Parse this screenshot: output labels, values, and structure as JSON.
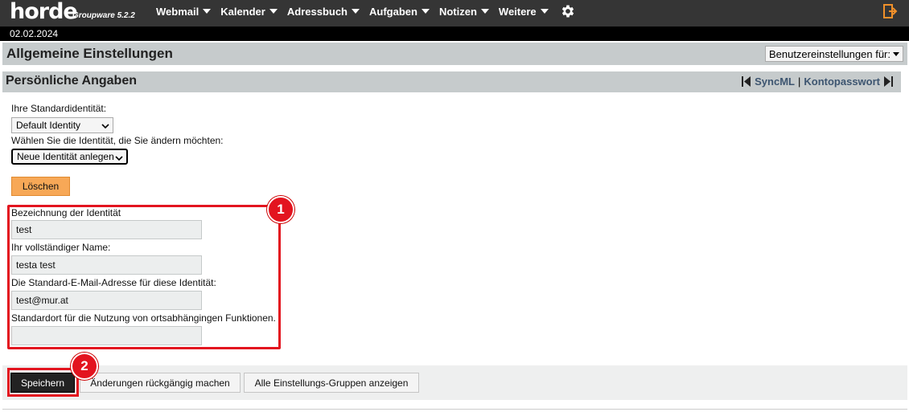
{
  "app": {
    "logo": "horde",
    "subtitle": "Groupware 5.2.2"
  },
  "nav": {
    "items": [
      {
        "label": "Webmail"
      },
      {
        "label": "Kalender"
      },
      {
        "label": "Adressbuch"
      },
      {
        "label": "Aufgaben"
      },
      {
        "label": "Notizen"
      },
      {
        "label": "Weitere"
      }
    ],
    "icons": [
      "gear-icon",
      "logout-icon"
    ]
  },
  "date": "02.02.2024",
  "page": {
    "title": "Allgemeine Einstellungen",
    "pref_select": "Benutzereinstellungen für:"
  },
  "section": {
    "title": "Persönliche Angaben",
    "link_syncml": "SyncML",
    "link_separator": "|",
    "link_password": "Kontopasswort"
  },
  "form": {
    "default_identity_label": "Ihre Standardidentität:",
    "default_identity_value": "Default Identity",
    "choose_identity_label": "Wählen Sie die Identität, die Sie ändern möchten:",
    "choose_identity_value": "Neue Identität anlegen",
    "delete_button": "Löschen",
    "identity_name_label": "Bezeichnung der Identität",
    "identity_name_value": "test",
    "full_name_label": "Ihr vollständiger Name:",
    "full_name_value": "testa test",
    "email_label": "Die Standard-E-Mail-Adresse für diese Identität:",
    "email_value": "test@mur.at",
    "location_label": "Standardort für die Nutzung von ortsabhängingen Funktionen.",
    "location_value": ""
  },
  "footer": {
    "save_button": "Speichern",
    "undo_button": "Änderungen rückgängig machen",
    "show_groups_button": "Alle Einstellungs-Gruppen anzeigen"
  },
  "annotations": {
    "badge1": "1",
    "badge2": "2"
  },
  "colors": {
    "topbar": "#353535",
    "header": "#c6cbcc",
    "accent_orange": "#f7a857",
    "annotation_red": "#e3141f"
  }
}
